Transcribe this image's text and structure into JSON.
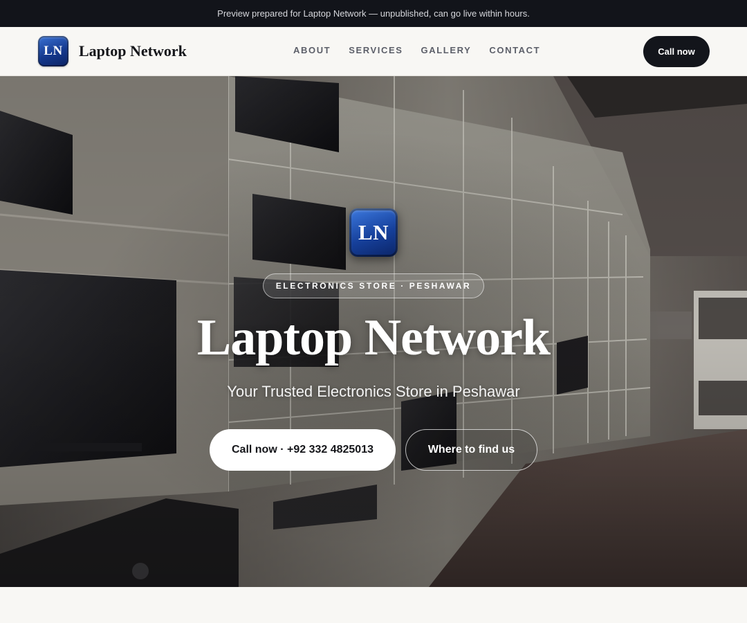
{
  "banner": {
    "text": "Preview prepared for Laptop Network — unpublished, can go live within hours."
  },
  "header": {
    "logo_initials": "LN",
    "brand_name": "Laptop Network",
    "nav": [
      {
        "label": "ABOUT"
      },
      {
        "label": "SERVICES"
      },
      {
        "label": "GALLERY"
      },
      {
        "label": "CONTACT"
      }
    ],
    "cta_label": "Call now"
  },
  "hero": {
    "logo_initials": "LN",
    "eyebrow": "ELECTRONICS STORE · PESHAWAR",
    "title": "Laptop Network",
    "subtitle": "Your Trusted Electronics Store in Peshawar",
    "primary_button": "Call now · +92 332 4825013",
    "secondary_button": "Where to find us",
    "background_image": "electronics-store-interior"
  },
  "colors": {
    "dark": "#13151b",
    "brand_blue": "#16409b",
    "page_bg": "#f8f7f4"
  }
}
